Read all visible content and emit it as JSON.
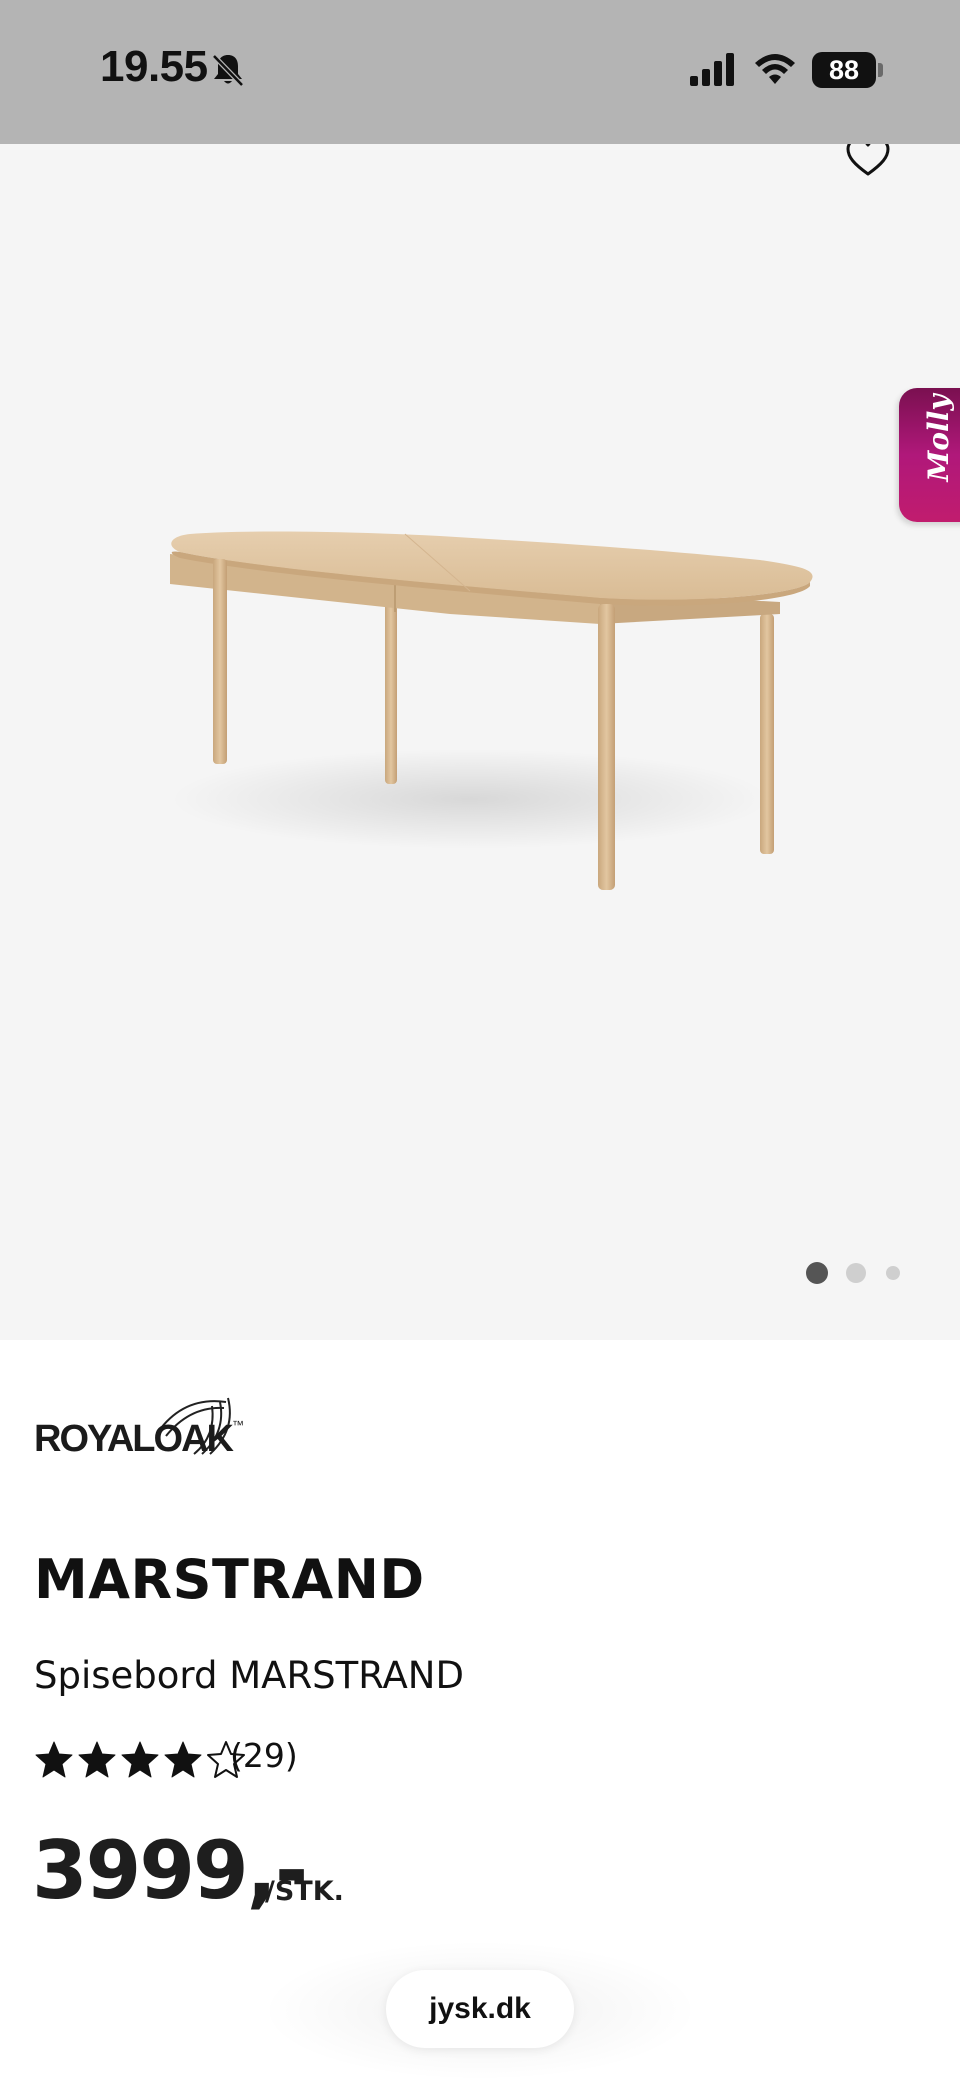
{
  "status_bar": {
    "time": "19.55",
    "battery_level": "88",
    "icons": [
      "bell-slash-icon",
      "cellular-signal-icon",
      "wifi-icon",
      "battery-icon"
    ]
  },
  "gallery": {
    "favorite_icon": "heart-outline-icon",
    "image": "dining-table-photo",
    "molly_label": "Molly",
    "page_indicator": {
      "pages": 3,
      "current": 1
    }
  },
  "product": {
    "brand_logo_text": "ROYALOAK",
    "brand_trademark": "™",
    "name": "MARSTRAND",
    "subtitle": "Spisebord MARSTRAND",
    "rating": {
      "stars": 4,
      "max_stars": 5
    },
    "review_count": "(29)",
    "price": "3999,-",
    "price_unit": "/STK."
  },
  "browser": {
    "url": "jysk.dk"
  },
  "colors": {
    "status_bar_bg": "#b4b4b4",
    "gallery_bg": "#f5f5f5",
    "molly_gradient_start": "#7a1050",
    "molly_gradient_end": "#c11c6e",
    "text": "#111111"
  }
}
